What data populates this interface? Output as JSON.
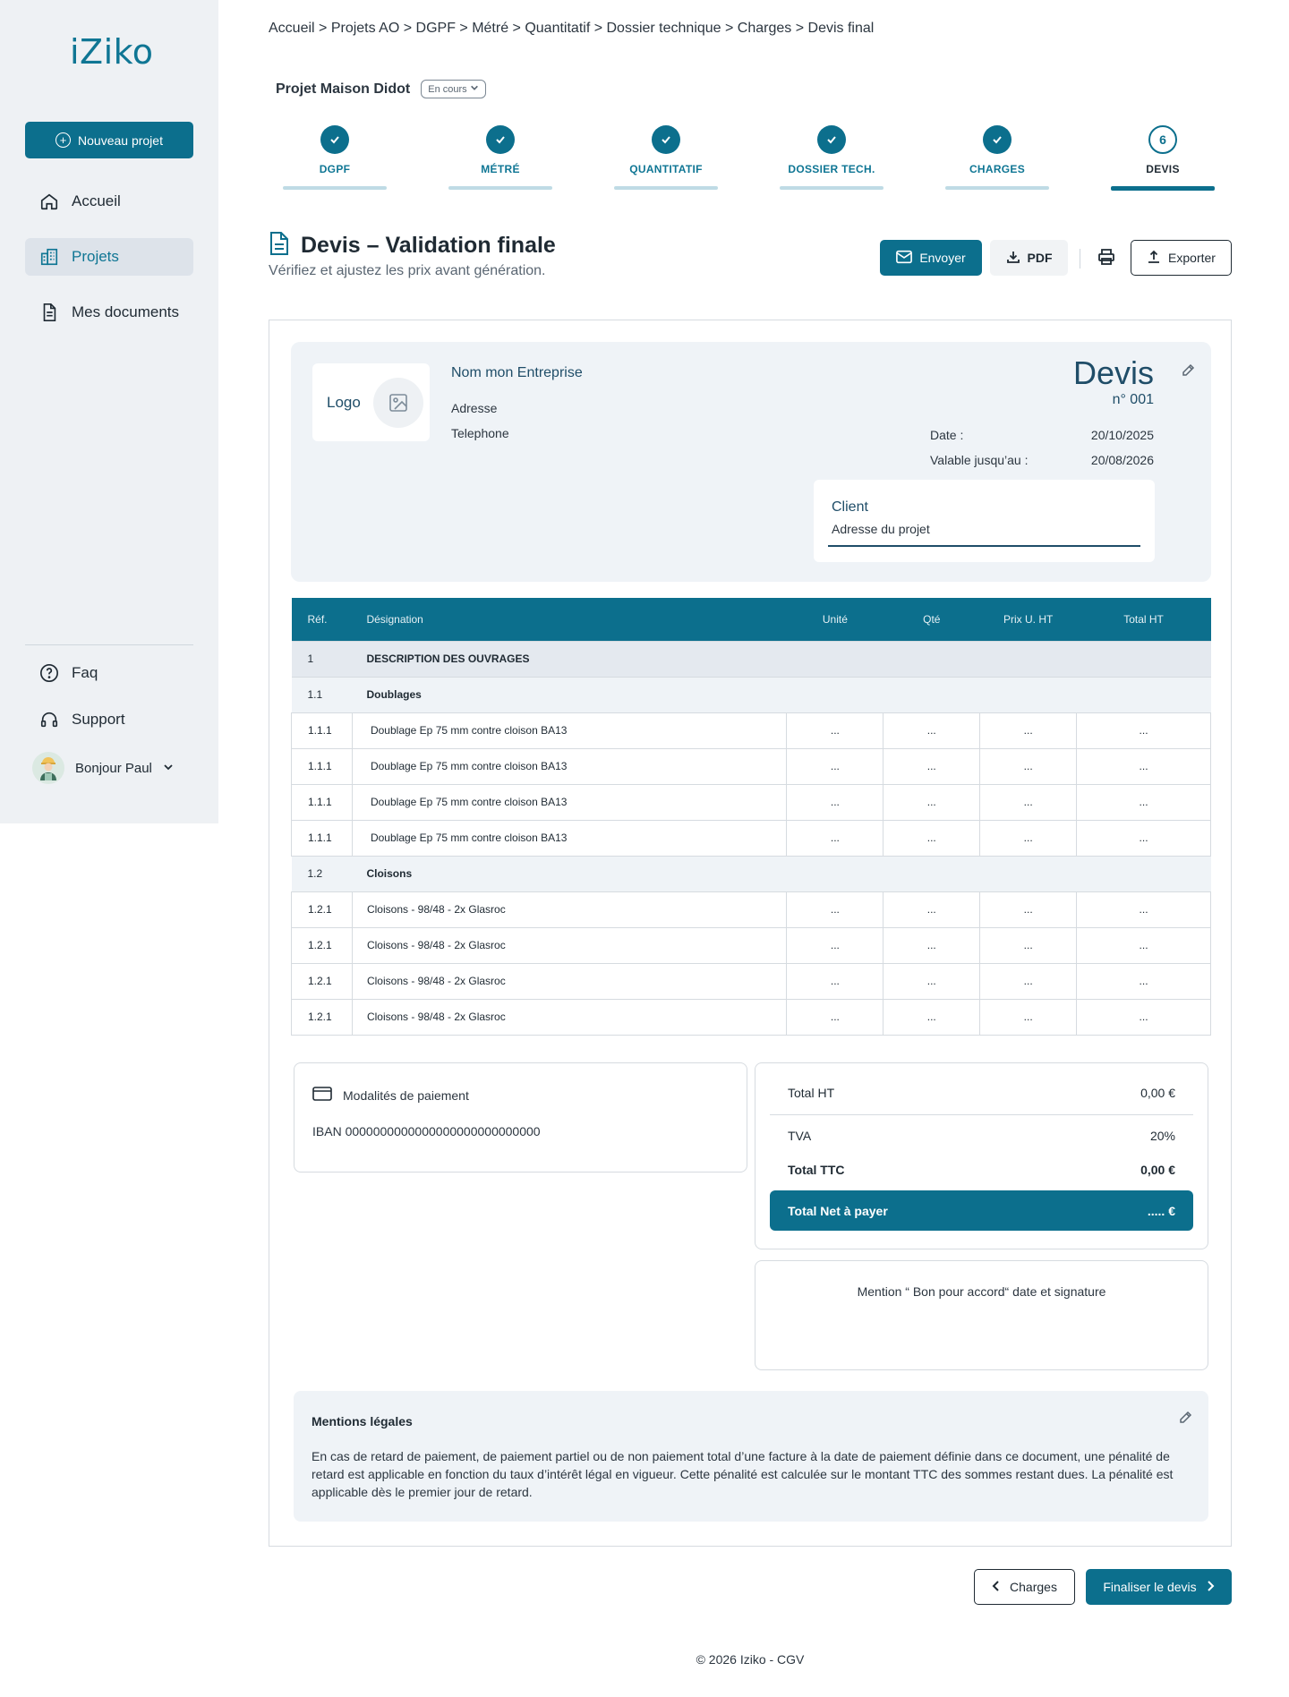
{
  "sidebar": {
    "logo": "iZiko",
    "new_project": "Nouveau projet",
    "nav": [
      {
        "label": "Accueil"
      },
      {
        "label": "Projets"
      },
      {
        "label": "Mes documents"
      }
    ],
    "bottom": [
      {
        "label": "Faq"
      },
      {
        "label": "Support"
      }
    ],
    "user": "Bonjour Paul"
  },
  "breadcrumb": "Accueil > Projets AO > DGPF > Métré > Quantitatif > Dossier technique > Charges > Devis final",
  "project": {
    "title": "Projet Maison Didot",
    "status": "En cours"
  },
  "steps": [
    {
      "label": "DGPF"
    },
    {
      "label": "MÉTRÉ"
    },
    {
      "label": "QUANTITATIF"
    },
    {
      "label": "DOSSIER TECH."
    },
    {
      "label": "CHARGES"
    },
    {
      "label": "DEVIS",
      "number": "6"
    }
  ],
  "page": {
    "title": "Devis – Validation finale",
    "subtitle": "Vérifiez et ajustez les prix avant génération."
  },
  "toolbar": {
    "send": "Envoyer",
    "pdf": "PDF",
    "export": "Exporter"
  },
  "header": {
    "logo": "Logo",
    "company_name": "Nom mon Entreprise",
    "address": "Adresse",
    "phone": "Telephone",
    "doc_title": "Devis",
    "doc_number": "n° 001",
    "date_label": "Date :",
    "date_value": "20/10/2025",
    "valid_label": "Valable jusqu’au :",
    "valid_value": "20/08/2026",
    "client_title": "Client",
    "client_address": "Adresse du projet"
  },
  "table": {
    "columns": [
      "Réf.",
      "Désignation",
      "Unité",
      "Qté",
      "Prix U. HT",
      "Total HT"
    ],
    "section": {
      "ref": "1",
      "label": "DESCRIPTION DES OUVRAGES"
    },
    "groups": [
      {
        "ref": "1.1",
        "label": "Doublages",
        "rows": [
          {
            "ref": "1.1.1",
            "designation": "Doublage Ep 75 mm contre cloison BA13",
            "unit": "...",
            "qty": "...",
            "price": "...",
            "total": "..."
          },
          {
            "ref": "1.1.1",
            "designation": "Doublage Ep 75 mm contre cloison BA13",
            "unit": "...",
            "qty": "...",
            "price": "...",
            "total": "..."
          },
          {
            "ref": "1.1.1",
            "designation": "Doublage Ep 75 mm contre cloison BA13",
            "unit": "...",
            "qty": "...",
            "price": "...",
            "total": "..."
          },
          {
            "ref": "1.1.1",
            "designation": "Doublage Ep 75 mm contre cloison BA13",
            "unit": "...",
            "qty": "...",
            "price": "...",
            "total": "..."
          }
        ]
      },
      {
        "ref": "1.2",
        "label": "Cloisons",
        "rows": [
          {
            "ref": "1.2.1",
            "designation": "Cloisons - 98/48 - 2x Glasroc",
            "unit": "...",
            "qty": "...",
            "price": "...",
            "total": "..."
          },
          {
            "ref": "1.2.1",
            "designation": "Cloisons - 98/48 - 2x Glasroc",
            "unit": "...",
            "qty": "...",
            "price": "...",
            "total": "..."
          },
          {
            "ref": "1.2.1",
            "designation": "Cloisons - 98/48 - 2x Glasroc",
            "unit": "...",
            "qty": "...",
            "price": "...",
            "total": "..."
          },
          {
            "ref": "1.2.1",
            "designation": "Cloisons - 98/48 - 2x Glasroc",
            "unit": "...",
            "qty": "...",
            "price": "...",
            "total": "..."
          }
        ]
      }
    ]
  },
  "payment": {
    "title": "Modalités de paiement",
    "iban": "IBAN 0000000000000000000000000000"
  },
  "totals": {
    "ht_label": "Total HT",
    "ht_value": "0,00 €",
    "tva_label": "TVA",
    "tva_value": "20%",
    "ttc_label": "Total TTC",
    "ttc_value": "0,00 €",
    "net_label": "Total Net à payer",
    "net_value": "..... €"
  },
  "signature": "Mention “ Bon pour accord“ date et signature",
  "legal": {
    "title": "Mentions légales",
    "text": "En cas de retard de paiement, de paiement partiel ou de non paiement total d’une facture à la date de paiement définie dans ce document, une pénalité de retard est applicable en fonction du taux d’intérêt légal en vigueur. Cette pénalité est calculée sur le montant TTC des sommes restant dues. La pénalité est applicable dès le premier jour de retard."
  },
  "nav_buttons": {
    "prev": "Charges",
    "next": "Finaliser le devis"
  },
  "footer": "© 2026 Iziko - CGV",
  "colors": {
    "primary": "#0c6f8d",
    "sidebar_bg": "#eef1f4",
    "card_bg": "#eff3f7"
  }
}
